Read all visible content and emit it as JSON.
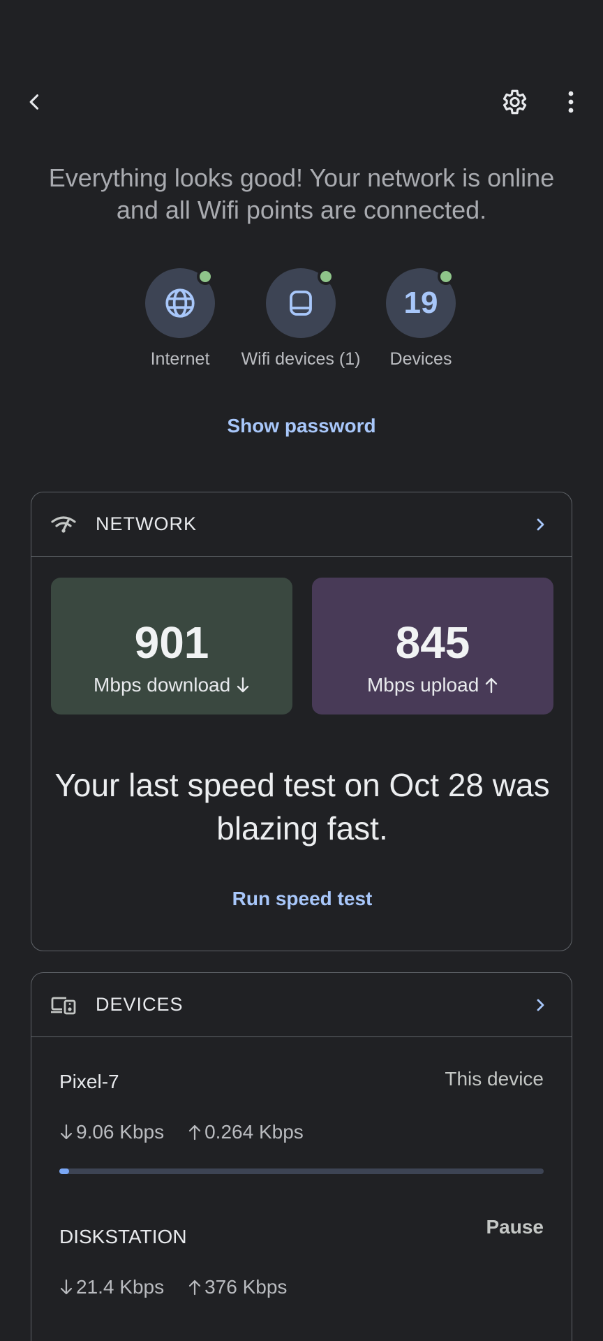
{
  "status_message": "Everything looks good! Your network is online and all Wifi points are connected.",
  "status_items": [
    {
      "label": "Internet",
      "icon": "globe-icon"
    },
    {
      "label": "Wifi devices (1)",
      "icon": "wifi-point-icon"
    },
    {
      "label": "Devices",
      "value": "19"
    }
  ],
  "show_password_label": "Show password",
  "network": {
    "title": "NETWORK",
    "download_value": "901",
    "download_label": "Mbps download",
    "upload_value": "845",
    "upload_label": "Mbps upload",
    "speed_message": "Your last speed test on Oct 28 was blazing fast.",
    "run_test_label": "Run speed test"
  },
  "devices": {
    "title": "DEVICES",
    "items": [
      {
        "name": "Pixel-7",
        "right_text": "This device",
        "down": "9.06 Kbps",
        "up": "0.264 Kbps",
        "usage_fraction": 0.02
      },
      {
        "name": "DISKSTATION",
        "right_text": "Pause",
        "down": "21.4 Kbps",
        "up": "376 Kbps"
      }
    ]
  },
  "colors": {
    "background": "#202124",
    "accent": "#a8c7fa",
    "online_dot": "#8fc58a",
    "download_box": "#3a4840",
    "upload_box": "#483a57"
  }
}
